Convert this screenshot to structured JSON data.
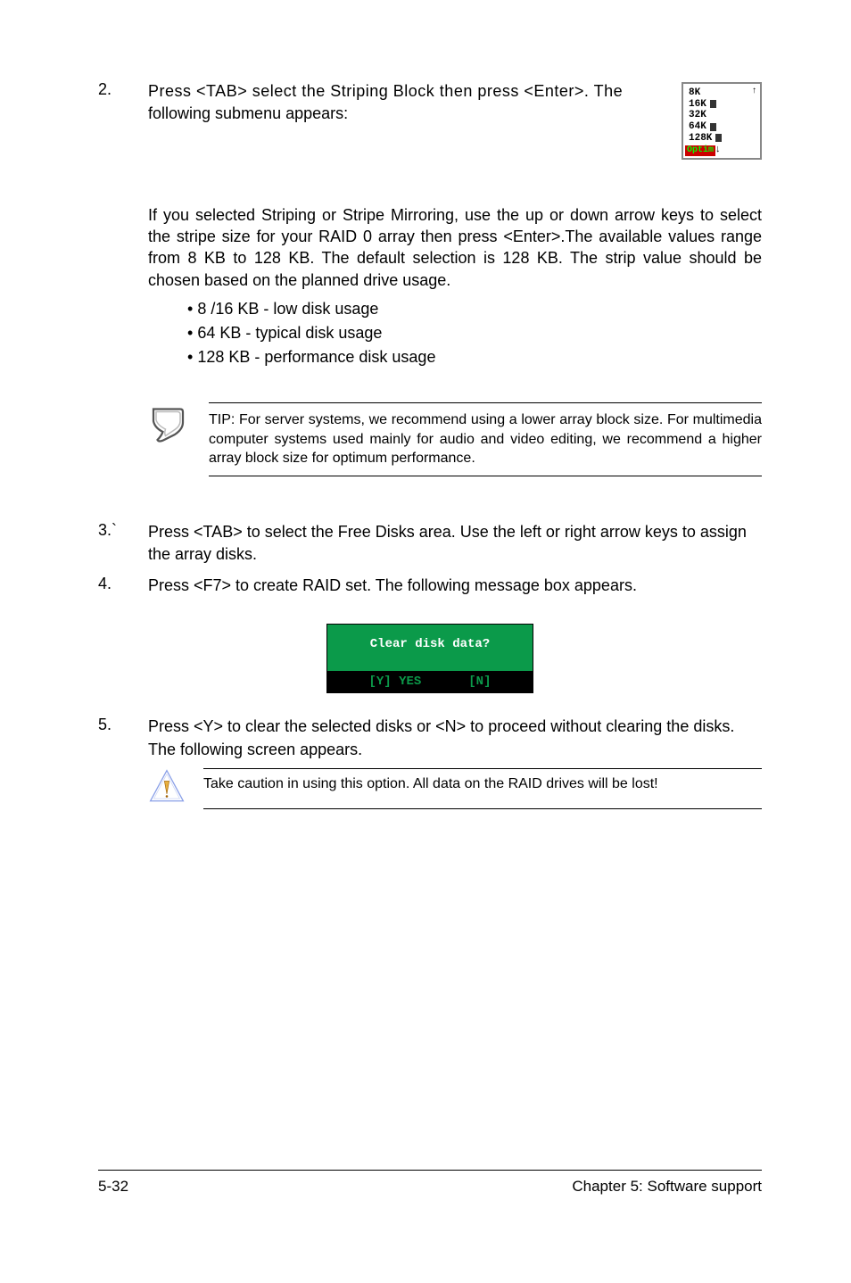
{
  "step2": {
    "num": "2.",
    "text_a": "Press <TAB> select the Striping Block then press <Enter>. The",
    "text_b": "following submenu appears:"
  },
  "submenu": {
    "l1": "8K",
    "l2": "16K",
    "l3": "32K",
    "l4": "64K",
    "l5": "128K",
    "sel": " Optim ",
    "up": "↑",
    "dn": "↓"
  },
  "para1": "If you selected Striping or Stripe Mirroring, use the up or down arrow keys to select the stripe size for your RAID 0 array then press <Enter>.The available values range from 8 KB to 128 KB. The default selection is 128 KB. The strip value should be chosen based on the planned drive usage.",
  "bullets": {
    "b1": "8 /16 KB - low disk usage",
    "b2": "64 KB - typical disk usage",
    "b3": "128 KB - performance disk usage"
  },
  "tip": "TIP: For server systems, we recommend using a lower array block size. For multimedia computer systems used mainly for audio and video editing, we recommend a higher array block size for optimum performance.",
  "step3": {
    "num": "3.`",
    "text": "Press <TAB> to select the Free Disks area. Use the left or right arrow keys to assign the array disks."
  },
  "step4": {
    "num": "4.",
    "text": "Press <F7> to create RAID set. The following message box appears."
  },
  "dialog": {
    "title": "Clear disk data?",
    "yes": "[Y] YES",
    "no": "[N]"
  },
  "step5": {
    "num": "5.",
    "text": "Press <Y> to clear the selected disks or <N> to proceed without clearing the disks. The following screen appears."
  },
  "caution": "Take caution in using this option. All data on the RAID drives will be lost!",
  "footer": {
    "left": "5-32",
    "right": "Chapter 5: Software support"
  }
}
